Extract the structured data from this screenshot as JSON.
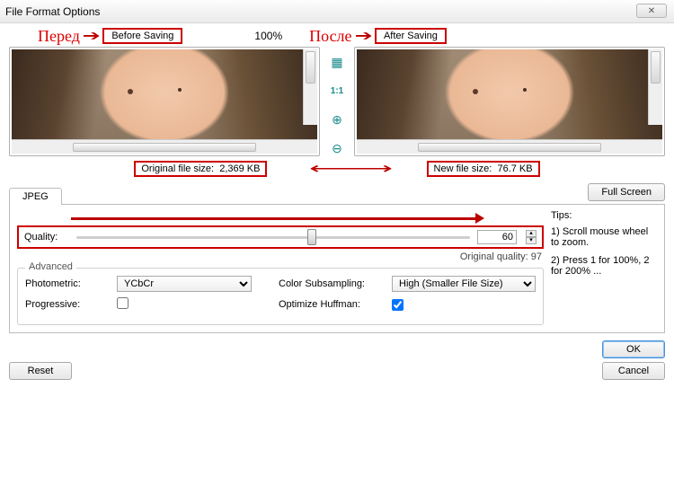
{
  "window": {
    "title": "File Format Options"
  },
  "annotations": {
    "before_ru": "Перед",
    "after_ru": "После",
    "before_label": "Before Saving",
    "after_label": "After Saving",
    "zoom_percent": "100%"
  },
  "tools": {
    "crop": "▦",
    "ratio": "1:1",
    "zoom_in": "⊕",
    "zoom_out": "⊖"
  },
  "sizes": {
    "original_label": "Original file size:",
    "original_value": "2,369 KB",
    "new_label": "New file size:",
    "new_value": "76.7 KB"
  },
  "tabs": {
    "jpeg": "JPEG"
  },
  "buttons": {
    "full_screen": "Full Screen",
    "ok": "OK",
    "cancel": "Cancel",
    "reset": "Reset"
  },
  "quality": {
    "label": "Quality:",
    "value": "60",
    "original_label": "Original quality:",
    "original_value": "97"
  },
  "advanced": {
    "legend": "Advanced",
    "photometric_label": "Photometric:",
    "photometric_value": "YCbCr",
    "subsampling_label": "Color Subsampling:",
    "subsampling_value": "High (Smaller File Size)",
    "progressive_label": "Progressive:",
    "huffman_label": "Optimize Huffman:"
  },
  "tips": {
    "header": "Tips:",
    "t1": "1) Scroll mouse wheel to zoom.",
    "t2": "2) Press 1 for 100%, 2 for 200% ..."
  }
}
